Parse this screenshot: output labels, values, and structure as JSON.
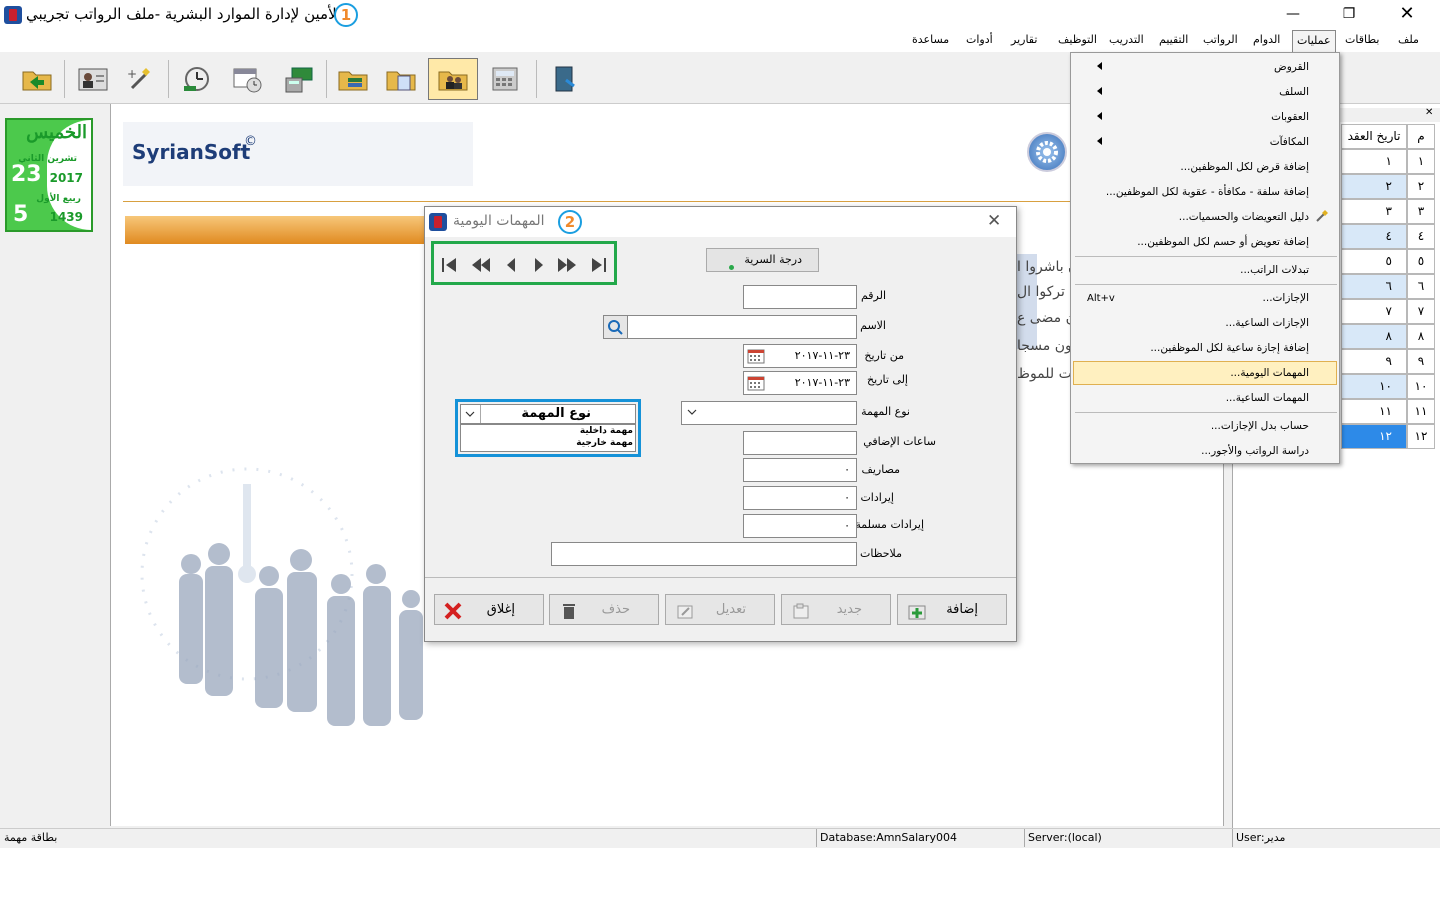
{
  "window": {
    "title": "الأمين لإدارة الموارد البشرية -ملف الرواتب تجريبي",
    "marker": "1"
  },
  "menu": [
    "ملف",
    "بطاقات",
    "عمليات",
    "الدوام",
    "الرواتب",
    "التقييم",
    "التدريب",
    "التوظيف",
    "تقارير",
    "أدوات",
    "مساعدة"
  ],
  "operations_menu": {
    "items": [
      "القروض",
      "السلف",
      "العقوبات",
      "المكافآت",
      "إضافة قرض لكل الموظفين...",
      "إضافة سلفة - مكافأة - عقوبة لكل الموظفين...",
      "دليل التعويضات والحسميات...",
      "إضافة تعويض أو حسم لكل الموظفين...",
      "تبدلات الراتب...",
      "الإجازات...",
      "الإجازات الساعية...",
      "إضافة إجازة ساعية لكل الموظفين...",
      "المهمات اليومية...",
      "المهمات الساعية...",
      "حساب بدل الإجازات...",
      "دراسة الرواتب والأجور..."
    ],
    "shortcut": "Alt+v",
    "highlighted": "المهمات اليومية..."
  },
  "calendar": {
    "day": "الخميس",
    "month": "تشرين الثاني",
    "day_num": "23",
    "year": "2017",
    "hijri_month": "ربيع الأول",
    "hijri_day": "5",
    "hijri_year": "1439"
  },
  "brand": {
    "name": "SyrianSoft",
    "mark": "©"
  },
  "bg_text": [
    "ن باشروا ا",
    "ن تركوا ال",
    "ن مضى ع",
    "ون مسجا",
    "ت للموظ"
  ],
  "right_grid": {
    "headers": [
      "م",
      "تاريخ العقد"
    ],
    "rows": [
      [
        "١",
        "١"
      ],
      [
        "٢",
        "٢"
      ],
      [
        "٣",
        "٣"
      ],
      [
        "٤",
        "٤"
      ],
      [
        "٥",
        "٥"
      ],
      [
        "٦",
        "٦"
      ],
      [
        "٧",
        "٧"
      ],
      [
        "٨",
        "٨"
      ],
      [
        "٩",
        "٩"
      ],
      [
        "١٠",
        "١٠"
      ],
      [
        "١١",
        "١١"
      ],
      [
        "١٢",
        "١٢"
      ]
    ]
  },
  "dialog": {
    "title": "المهمات اليومية",
    "marker": "2",
    "secrecy_button": "درجة السرية",
    "fields": {
      "number": "الرقم",
      "name": "الاسم",
      "from_date": "من تاريخ",
      "from_date_value": "٢٣-١١-٢٠١٧",
      "to_date": "إلى تاريخ",
      "to_date_value": "٢٣-١١-٢٠١٧",
      "task_type": "نوع المهمة",
      "overtime": "ساعات الإضافي",
      "expenses": "مصاريف",
      "expenses_value": "٠",
      "revenues": "إيرادات",
      "revenues_value": "٠",
      "delivered_revenues": "إيرادات مسلمة",
      "delivered_revenues_value": "٠",
      "notes": "ملاحظات"
    },
    "task_type_dropdown": {
      "header": "نوع المهمة",
      "options": [
        "مهمة داخلية",
        "مهمة خارجية"
      ]
    },
    "buttons": {
      "add": "إضافة",
      "new": "جديد",
      "edit": "تعديل",
      "delete": "حذف",
      "close": "إغلاق"
    }
  },
  "status": {
    "left": "بطاقة مهمة",
    "database": "Database:AmnSalary004",
    "server": "Server:(local)",
    "user": "User:مدير"
  }
}
